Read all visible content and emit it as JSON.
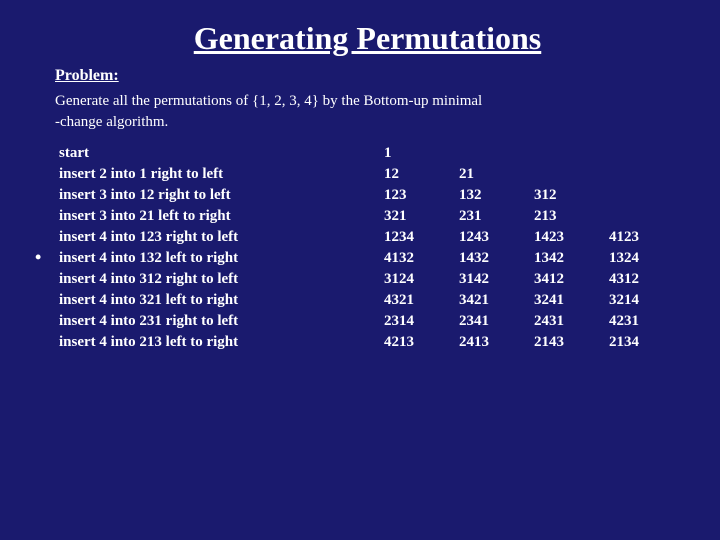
{
  "title": "Generating Permutations",
  "problem_label": "Problem:",
  "problem_text": "Generate all the permutations of {1, 2, 3, 4} by the Bottom-up minimal\n-change algorithm.",
  "rows": [
    {
      "label": "start",
      "nums": [
        "1"
      ],
      "has_bullet": false
    },
    {
      "label": "insert 2 into 1 right to left",
      "nums": [
        "12",
        "21"
      ],
      "has_bullet": false
    },
    {
      "label": "insert 3 into 12 right to left",
      "nums": [
        "123",
        "132",
        "312"
      ],
      "has_bullet": false
    },
    {
      "label": "insert 3 into 21 left to right",
      "nums": [
        "321",
        "231",
        "213"
      ],
      "has_bullet": false
    },
    {
      "label": "insert 4 into 123 right to left",
      "nums": [
        "1234",
        "1243",
        "1423",
        "4123"
      ],
      "has_bullet": false
    },
    {
      "label": "insert 4 into 132 left to right",
      "nums": [
        "4132",
        "1432",
        "1342",
        "1324"
      ],
      "has_bullet": true
    },
    {
      "label": "insert 4 into 312 right to left",
      "nums": [
        "3124",
        "3142",
        "3412",
        "4312"
      ],
      "has_bullet": false
    },
    {
      "label": "insert 4 into 321  left to right",
      "nums": [
        "4321",
        "3421",
        "3241",
        "3214"
      ],
      "has_bullet": false
    },
    {
      "label": "insert 4 into 231 right to left",
      "nums": [
        "2314",
        "2341",
        "2431",
        "4231"
      ],
      "has_bullet": false
    },
    {
      "label": "insert 4 into 213 left to right",
      "nums": [
        "4213",
        "2413",
        "2143",
        "2134"
      ],
      "has_bullet": false
    }
  ]
}
